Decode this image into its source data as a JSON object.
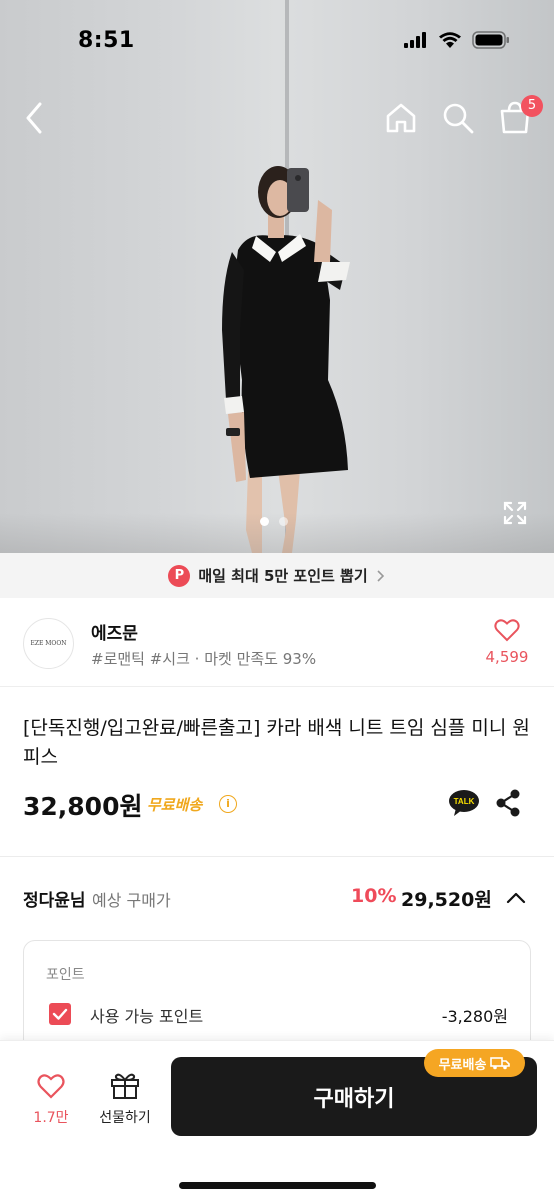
{
  "status_bar": {
    "time": "8:51"
  },
  "nav": {
    "cart_count": "5"
  },
  "point_banner": {
    "icon_letter": "P",
    "text": "매일 최대 5만 포인트 뽑기"
  },
  "store": {
    "logo_text": "EZE MOON",
    "name": "에즈문",
    "tags": "#로맨틱 #시크 · 마켓 만족도 93%",
    "like_count": "4,599"
  },
  "product": {
    "title": "[단독진행/입고완료/빠른출고] 카라 배색 니트 트임 심플 미니 원피스",
    "price": "32,800원",
    "free_shipping": "무료배송",
    "talk_label": "TALK"
  },
  "expected_price": {
    "user": "정다윤님",
    "label": "예상 구매가",
    "discount": "10%",
    "price": "29,520원"
  },
  "points_card": {
    "header": "포인트",
    "item_label": "사용 가능 포인트",
    "item_amount": "-3,280원"
  },
  "bottom_bar": {
    "like_count": "1.7만",
    "gift_label": "선물하기",
    "buy_label": "구매하기",
    "buy_badge": "무료배송"
  },
  "colors": {
    "accent": "#ec4b56",
    "shipping": "#f0a81e",
    "buy_button": "#1a1a1a"
  },
  "carousel": {
    "total": 2,
    "active": 1
  }
}
